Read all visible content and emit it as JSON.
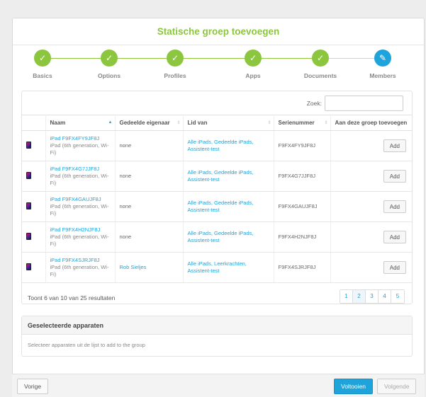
{
  "dialog": {
    "title": "Statische groep toevoegen"
  },
  "steps": [
    {
      "label": "Basics",
      "icon": "checkmark-icon",
      "glyph": "✓",
      "state": "done"
    },
    {
      "label": "Options",
      "icon": "checkmark-icon",
      "glyph": "✓",
      "state": "done"
    },
    {
      "label": "Profiles",
      "icon": "checkmark-icon",
      "glyph": "✓",
      "state": "done"
    },
    {
      "label": "Apps",
      "icon": "checkmark-icon",
      "glyph": "✓",
      "state": "done"
    },
    {
      "label": "Documents",
      "icon": "checkmark-icon",
      "glyph": "✓",
      "state": "done"
    },
    {
      "label": "Members",
      "icon": "pencil-icon",
      "glyph": "✎",
      "state": "active"
    }
  ],
  "search": {
    "label": "Zoek:",
    "value": ""
  },
  "table": {
    "columns": [
      "Naam",
      "Gedeelde eigenaar",
      "Lid van",
      "Serienummer",
      "Aan deze groep toevoegen"
    ],
    "rows": [
      {
        "name": "iPad F9FX4FY9JF8J",
        "model": "iPad (6th generation, Wi-Fi)",
        "owner": "none",
        "owner_link": false,
        "member_of": "Alle iPads, Gedeelde iPads, Assistent-test",
        "serial": "F9FX4FY9JF8J",
        "action": "Add"
      },
      {
        "name": "iPad F9FX4G7JJF8J",
        "model": "iPad (6th generation, Wi-Fi)",
        "owner": "none",
        "owner_link": false,
        "member_of": "Alle iPads, Gedeelde iPads, Assistent-test",
        "serial": "F9FX4G7JJF8J",
        "action": "Add"
      },
      {
        "name": "iPad F9FX4GAUJF8J",
        "model": "iPad (6th generation, Wi-Fi)",
        "owner": "none",
        "owner_link": false,
        "member_of": "Alle iPads, Gedeelde iPads, Assistent-test",
        "serial": "F9FX4GAUJF8J",
        "action": "Add"
      },
      {
        "name": "iPad F9FX4H2NJF8J",
        "model": "iPad (6th generation, Wi-Fi)",
        "owner": "none",
        "owner_link": false,
        "member_of": "Alle iPads, Gedeelde iPads, Assistent-test",
        "serial": "F9FX4H2NJF8J",
        "action": "Add"
      },
      {
        "name": "iPad F9FX4SJRJF8J",
        "model": "iPad (6th generation, Wi-Fi)",
        "owner": "Rob Sieljes",
        "owner_link": true,
        "member_of": "Alle iPads, Leerkrachten, Assistent-test",
        "serial": "F9FX4SJRJF8J",
        "action": "Add"
      }
    ]
  },
  "result_count": "Toont 6 van 10 van 25 resultaten",
  "pagination": {
    "pages": [
      "1",
      "2",
      "3",
      "4",
      "5"
    ],
    "current": "2"
  },
  "selected": {
    "title": "Geselecteerde apparaten",
    "placeholder": "Selecteer apparaten uit de lijst to add to the group"
  },
  "footer": {
    "prev": "Vorige",
    "finish": "Voltooien",
    "next": "Volgende"
  },
  "colors": {
    "accent_green": "#8cc63f",
    "accent_blue": "#1ea4db"
  }
}
